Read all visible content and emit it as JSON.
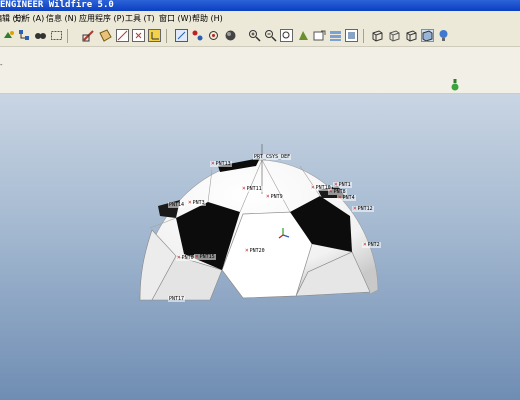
{
  "window": {
    "title": "ENGINEER Wildfire 5.0"
  },
  "menu": [
    {
      "id": "edit",
      "label": "编辑 (E)"
    },
    {
      "id": "analysis",
      "label": "分析 (A)"
    },
    {
      "id": "info",
      "label": "信息 (N)"
    },
    {
      "id": "applications",
      "label": "应用程序 (P)"
    },
    {
      "id": "tools",
      "label": "工具 (T)"
    },
    {
      "id": "window",
      "label": "窗口 (W)"
    },
    {
      "id": "help",
      "label": "帮助 (H)"
    }
  ],
  "toolbar_icons": [
    "regenerate-icon",
    "model-tree-icon",
    "find-icon",
    "select-box-icon",
    "sketch-icon",
    "datum-plane-icon",
    "datum-axis-icon",
    "datum-point-icon",
    "coord-sys-icon",
    "view-icon",
    "spin-center-icon",
    "datum-display-icon",
    "shade-icon",
    "zoom-in-icon",
    "zoom-out-icon",
    "refit-icon",
    "reorient-icon",
    "saved-views-icon",
    "layers-icon",
    "view-manager-icon",
    "wireframe-icon",
    "hidden-line-icon",
    "no-hidden-icon",
    "shading-icon",
    "appearance-icon"
  ],
  "model": {
    "csys_label": "PRT_CSYS_DEF",
    "points": [
      {
        "id": "p1",
        "label": "PNT13"
      },
      {
        "id": "p2",
        "label": "PNT11"
      },
      {
        "id": "p3",
        "label": "PNT10"
      },
      {
        "id": "p4",
        "label": "PNT1"
      },
      {
        "id": "p5",
        "label": "PNT9"
      },
      {
        "id": "p6",
        "label": "PNT4"
      },
      {
        "id": "p7",
        "label": "PNT12"
      },
      {
        "id": "p8",
        "label": "PNT8"
      },
      {
        "id": "p9",
        "label": "PNT3"
      },
      {
        "id": "p10",
        "label": "PNT14"
      },
      {
        "id": "p11",
        "label": "PNT20"
      },
      {
        "id": "p12",
        "label": "PNT15"
      },
      {
        "id": "p13",
        "label": "PNT0"
      },
      {
        "id": "p14",
        "label": "PNT2"
      },
      {
        "id": "p15",
        "label": "PNT17"
      }
    ]
  }
}
